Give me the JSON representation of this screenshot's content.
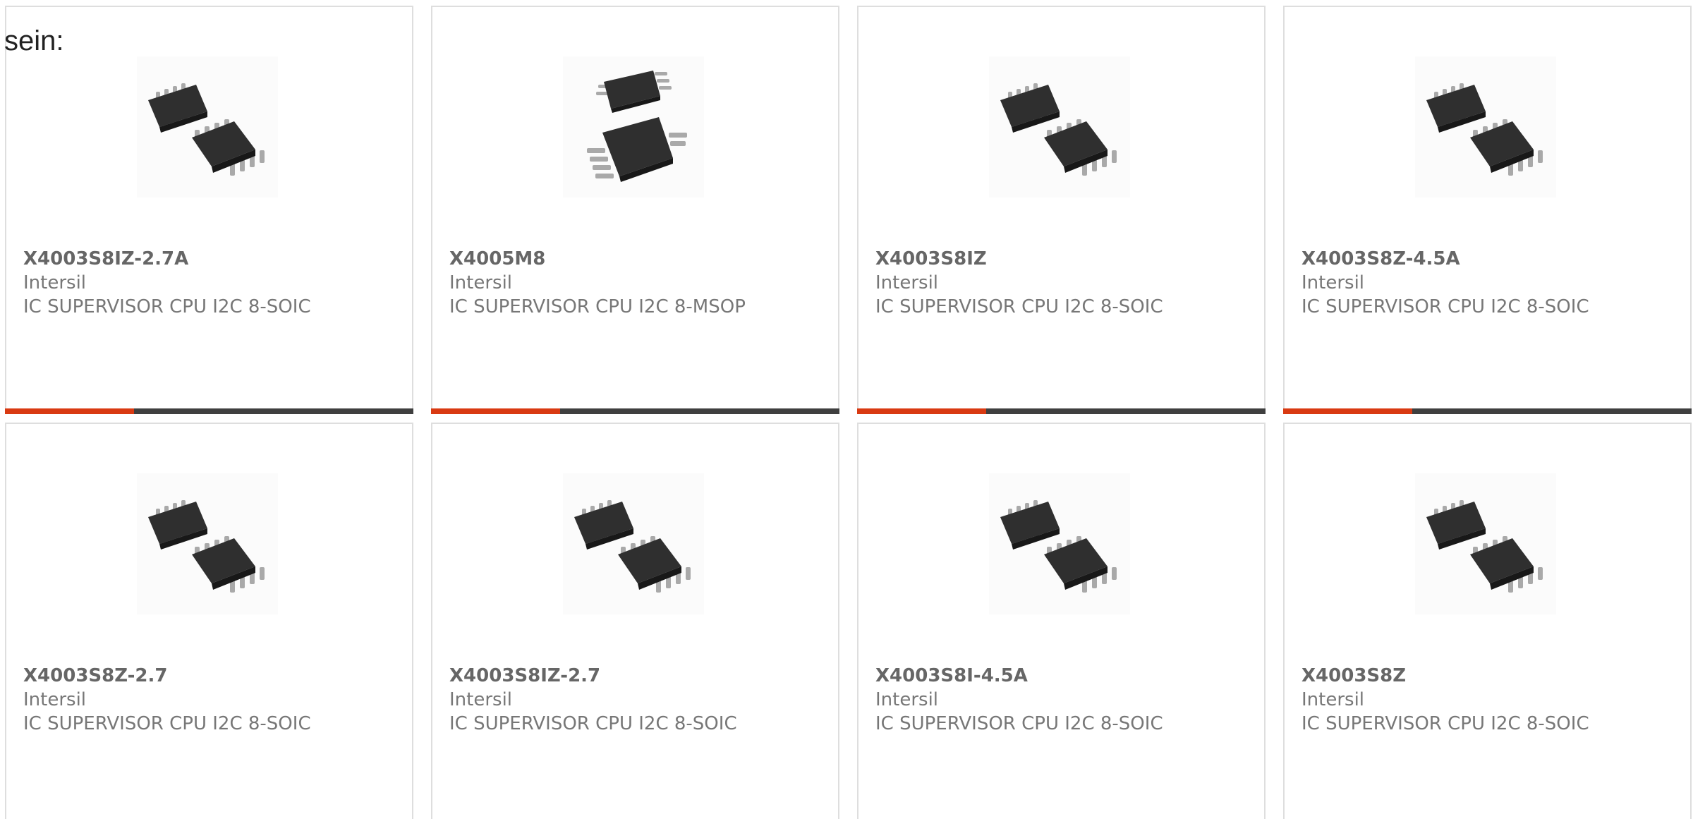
{
  "intro_text": "sein:",
  "colors": {
    "accent": "#d93a12",
    "bar_dark": "#3f3f3f",
    "card_border": "#dedede",
    "title_text": "#666666",
    "body_text": "#777777"
  },
  "products": [
    {
      "part": "X4003S8IZ-2.7A",
      "maker": "Intersil",
      "description": "IC SUPERVISOR CPU I2C 8-SOIC",
      "image_icon": "soic-chip-pair-icon"
    },
    {
      "part": "X4005M8",
      "maker": "Intersil",
      "description": "IC SUPERVISOR CPU I2C 8-MSOP",
      "image_icon": "msop-chip-pair-icon"
    },
    {
      "part": "X4003S8IZ",
      "maker": "Intersil",
      "description": "IC SUPERVISOR CPU I2C 8-SOIC",
      "image_icon": "soic-chip-pair-icon"
    },
    {
      "part": "X4003S8Z-4.5A",
      "maker": "Intersil",
      "description": "IC SUPERVISOR CPU I2C 8-SOIC",
      "image_icon": "soic-chip-pair-icon"
    },
    {
      "part": "X4003S8Z-2.7",
      "maker": "Intersil",
      "description": "IC SUPERVISOR CPU I2C 8-SOIC",
      "image_icon": "soic-chip-pair-icon"
    },
    {
      "part": "X4003S8IZ-2.7",
      "maker": "Intersil",
      "description": "IC SUPERVISOR CPU I2C 8-SOIC",
      "image_icon": "soic-chip-pair-icon"
    },
    {
      "part": "X4003S8I-4.5A",
      "maker": "Intersil",
      "description": "IC SUPERVISOR CPU I2C 8-SOIC",
      "image_icon": "soic-chip-pair-icon"
    },
    {
      "part": "X4003S8Z",
      "maker": "Intersil",
      "description": "IC SUPERVISOR CPU I2C 8-SOIC",
      "image_icon": "soic-chip-pair-icon"
    }
  ]
}
